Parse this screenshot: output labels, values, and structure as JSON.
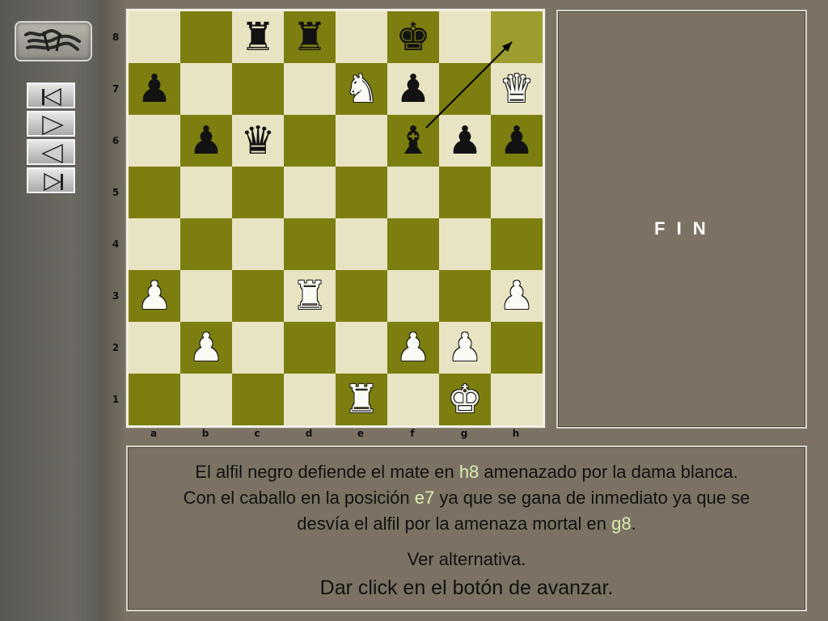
{
  "navigation": {
    "logo_icon": "signature-logo-icon",
    "buttons": [
      {
        "name": "first-move-button",
        "icon": "skip-to-start-icon"
      },
      {
        "name": "next-move-button",
        "icon": "play-forward-icon"
      },
      {
        "name": "previous-move-button",
        "icon": "play-back-icon"
      },
      {
        "name": "last-move-button",
        "icon": "skip-to-end-icon"
      }
    ]
  },
  "board": {
    "files": [
      "a",
      "b",
      "c",
      "d",
      "e",
      "f",
      "g",
      "h"
    ],
    "ranks": [
      "8",
      "7",
      "6",
      "5",
      "4",
      "3",
      "2",
      "1"
    ],
    "light_color": "#e8e4c3",
    "dark_color": "#7c7f0f",
    "pieces": [
      {
        "square": "c8",
        "glyph": "♜",
        "side": "black"
      },
      {
        "square": "d8",
        "glyph": "♜",
        "side": "black"
      },
      {
        "square": "f8",
        "glyph": "♚",
        "side": "black"
      },
      {
        "square": "a7",
        "glyph": "♟",
        "side": "black"
      },
      {
        "square": "e7",
        "glyph": "♞",
        "side": "white"
      },
      {
        "square": "f7",
        "glyph": "♟",
        "side": "black"
      },
      {
        "square": "h7",
        "glyph": "♛",
        "side": "white"
      },
      {
        "square": "b6",
        "glyph": "♟",
        "side": "black"
      },
      {
        "square": "c6",
        "glyph": "♛",
        "side": "black"
      },
      {
        "square": "f6",
        "glyph": "♝",
        "side": "black"
      },
      {
        "square": "g6",
        "glyph": "♟",
        "side": "black"
      },
      {
        "square": "h6",
        "glyph": "♟",
        "side": "black"
      },
      {
        "square": "a3",
        "glyph": "♟",
        "side": "white"
      },
      {
        "square": "d3",
        "glyph": "♜",
        "side": "white"
      },
      {
        "square": "h3",
        "glyph": "♟",
        "side": "white"
      },
      {
        "square": "b2",
        "glyph": "♟",
        "side": "white"
      },
      {
        "square": "f2",
        "glyph": "♟",
        "side": "white"
      },
      {
        "square": "g2",
        "glyph": "♟",
        "side": "white"
      },
      {
        "square": "e1",
        "glyph": "♜",
        "side": "white"
      },
      {
        "square": "g1",
        "glyph": "♚",
        "side": "white"
      }
    ],
    "arrow": {
      "from": "f6",
      "to": "h8",
      "color": "#000000"
    },
    "highlight_square": "h8"
  },
  "status_panel": {
    "text": "F I N"
  },
  "commentary": {
    "line1_a": "El alfil negro defiende el mate en ",
    "line1_hl": "h8",
    "line1_b": " amenazado por la dama blanca.",
    "line2_a": "Con el caballo en la posición ",
    "line2_hl": "e7",
    "line2_b": " ya que se gana de inmediato ya que se",
    "line3_a": "desvía el alfil por la amenaza mortal en ",
    "line3_hl": "g8",
    "line3_b": ".",
    "alt_link": "Ver alternativa.",
    "instruction": "Dar click en el botón de avanzar.",
    "highlight_color": "#d8ecb0"
  }
}
